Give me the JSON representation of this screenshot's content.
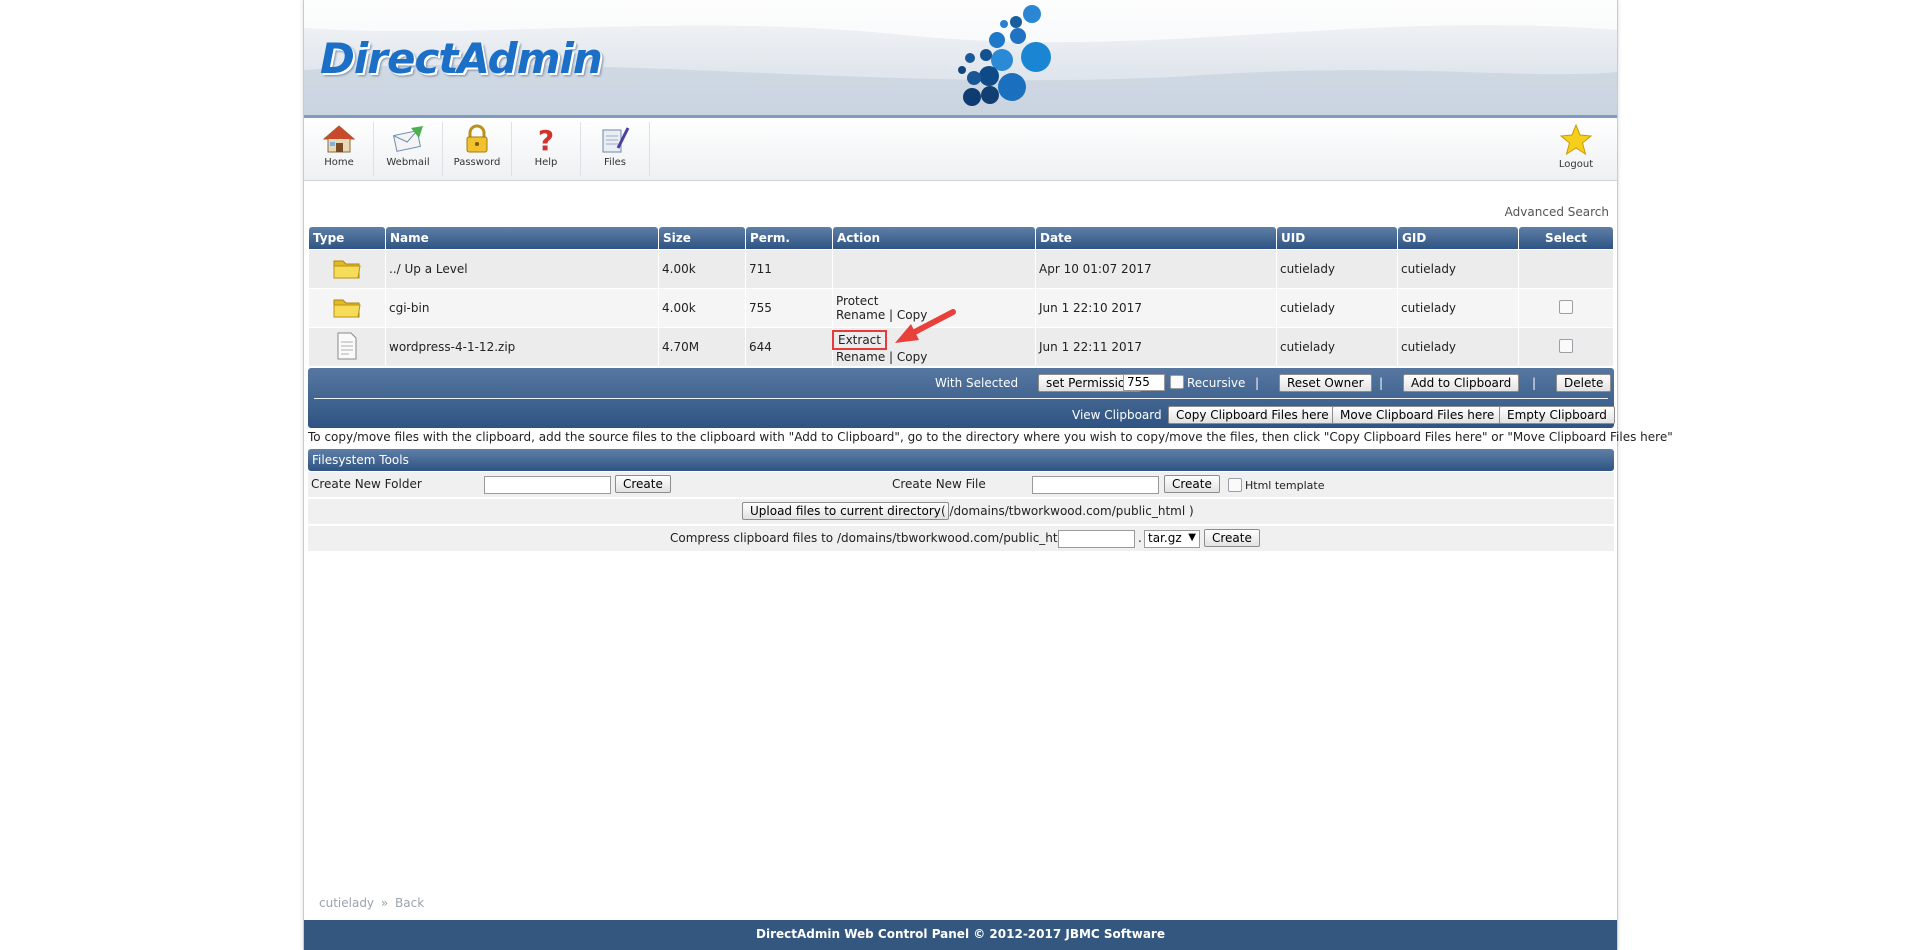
{
  "app": {
    "logo_text": "DirectAdmin"
  },
  "toolbar": {
    "items": [
      {
        "label": "Home",
        "icon": "home-icon"
      },
      {
        "label": "Webmail",
        "icon": "webmail-icon"
      },
      {
        "label": "Password",
        "icon": "lock-icon"
      },
      {
        "label": "Help",
        "icon": "help-icon"
      },
      {
        "label": "Files",
        "icon": "files-icon"
      }
    ],
    "logout": {
      "label": "Logout",
      "icon": "star-icon"
    }
  },
  "advanced_search": "Advanced Search",
  "table": {
    "headers": [
      "Type",
      "Name",
      "Size",
      "Perm.",
      "Action",
      "Date",
      "UID",
      "GID",
      "Select"
    ],
    "rows": [
      {
        "type": "folder",
        "name": "../ Up a Level",
        "size": "4.00k",
        "perm": "711",
        "action1": "",
        "action2": "",
        "date": "Apr 10 01:07 2017",
        "uid": "cutielady",
        "gid": "cutielady"
      },
      {
        "type": "folder",
        "name": "cgi-bin",
        "size": "4.00k",
        "perm": "755",
        "action1": "Protect",
        "action2": "Rename | Copy",
        "date": "Jun 1 22:10 2017",
        "uid": "cutielady",
        "gid": "cutielady"
      },
      {
        "type": "file",
        "name": "wordpress-4-1-12.zip",
        "size": "4.70M",
        "perm": "644",
        "action1": "Extract",
        "action2": "Rename | Copy",
        "date": "Jun 1 22:11 2017",
        "uid": "cutielady",
        "gid": "cutielady"
      }
    ]
  },
  "with_selected": {
    "label": "With Selected",
    "set_permission": "set Permission",
    "permission_value": "755",
    "recursive": "Recursive",
    "reset_owner": "Reset Owner",
    "add_to_clipboard": "Add to Clipboard",
    "delete": "Delete",
    "pipe": "|",
    "view_clipboard": "View Clipboard",
    "copy_clipboard": "Copy Clipboard Files here",
    "move_clipboard": "Move Clipboard Files here",
    "empty_clipboard": "Empty Clipboard"
  },
  "note": "To copy/move files with the clipboard, add the source files to the clipboard with \"Add to Clipboard\", go to the directory where you wish to copy/move the files, then click \"Copy Clipboard Files here\" or \"Move Clipboard Files here\"",
  "fs_tools": {
    "title": "Filesystem Tools",
    "new_folder_label": "Create New Folder",
    "new_file_label": "Create New File",
    "create": "Create",
    "html_template": "Html template",
    "upload": "Upload files to current directory",
    "upload_path": "( /domains/tbworkwood.com/public_html )",
    "compress_label": "Compress clipboard files to /domains/tbworkwood.com/public_html/",
    "dot": ".",
    "compress_ext": "tar.gz"
  },
  "breadcrumb": {
    "user": "cutielady",
    "sep": "»",
    "back": "Back"
  },
  "footer": "DirectAdmin Web Control Panel © 2012-2017 JBMC Software",
  "colors": {
    "header_blue": "#2f5483",
    "logo_blue": "#1b6fc7",
    "highlight_red": "#e53b3b"
  }
}
